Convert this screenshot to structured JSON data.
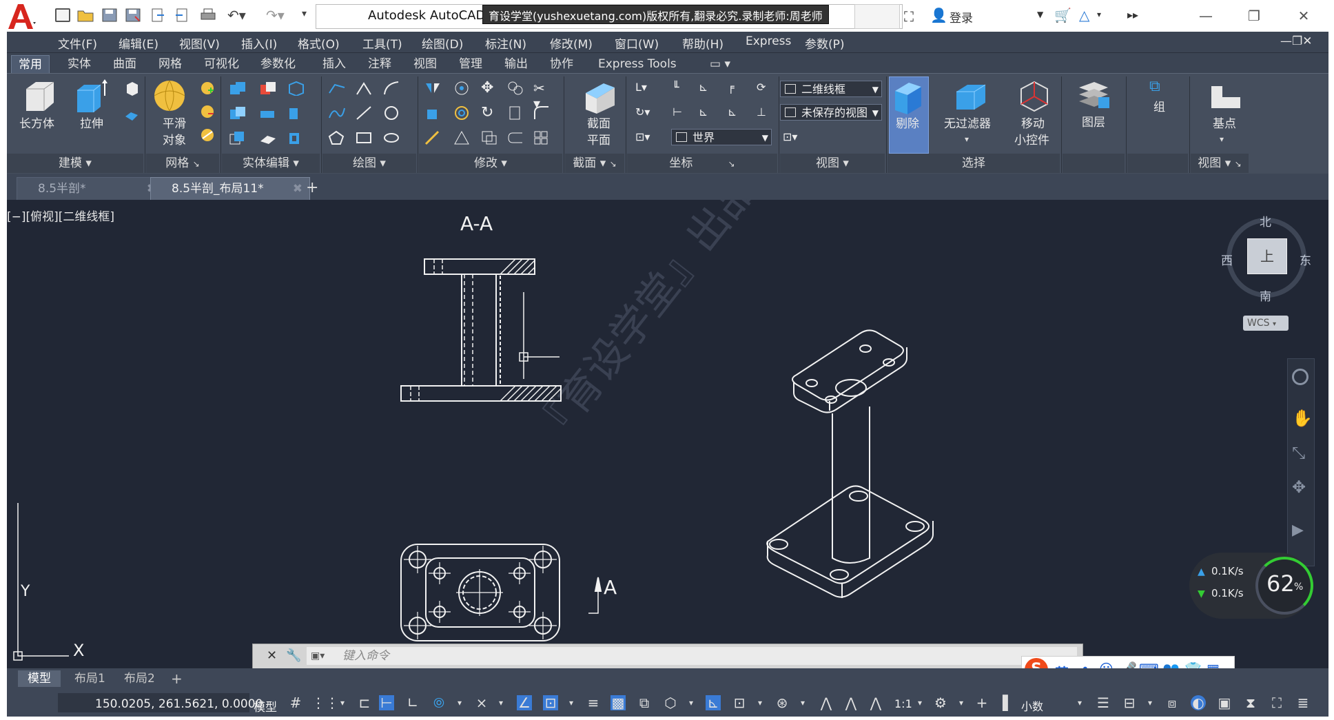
{
  "titlebar": {
    "app_title": "Autodesk AutoCAD",
    "banner": "育设学堂(yushexuetang.com)版权所有,翻录必究.录制老师:周老师",
    "login": "登录"
  },
  "menubar": {
    "items": [
      "文件(F)",
      "编辑(E)",
      "视图(V)",
      "插入(I)",
      "格式(O)",
      "工具(T)",
      "绘图(D)",
      "标注(N)",
      "修改(M)",
      "窗口(W)",
      "帮助(H)",
      "Express",
      "参数(P)"
    ]
  },
  "ribbon_tabs": {
    "items": [
      "常用",
      "实体",
      "曲面",
      "网格",
      "可视化",
      "参数化",
      "插入",
      "注释",
      "视图",
      "管理",
      "输出",
      "协作",
      "Express Tools"
    ]
  },
  "ribbon": {
    "box_label": "长方体",
    "extrude_label": "拉伸",
    "smooth_label_1": "平滑",
    "smooth_label_2": "对象",
    "section_plane_1": "截面",
    "section_plane_2": "平面",
    "visual_style": "二维线框",
    "named_view": "未保存的视图",
    "ucs": "世界",
    "cull_label": "剔除",
    "nofilter_label": "无过滤器",
    "gizmo_label_1": "移动",
    "gizmo_label_2": "小控件",
    "layer_label": "图层",
    "group_label": "组",
    "base_label": "基点",
    "panels": {
      "modeling": "建模",
      "mesh": "网格",
      "solid_edit": "实体编辑",
      "draw": "绘图",
      "modify": "修改",
      "section": "截面",
      "coords": "坐标",
      "view": "视图",
      "selection": "选择",
      "view2": "视图"
    }
  },
  "doctabs": {
    "tab1": "8.5半剖*",
    "tab2": "8.5半剖_布局11*"
  },
  "canvas": {
    "view_label": "[−][俯视][二维线框]",
    "section_title": "A-A",
    "section_marker": "A",
    "watermark": "『育设学堂』出品",
    "viewcube": {
      "north": "北",
      "south": "南",
      "east": "东",
      "west": "西",
      "face": "上",
      "wcs": "WCS"
    },
    "ucs_x": "X",
    "ucs_y": "Y"
  },
  "netwidget": {
    "up": "0.1K/s",
    "down": "0.1K/s",
    "percent": "62",
    "percent_sign": "%"
  },
  "cmdline": {
    "placeholder": "键入命令"
  },
  "layouttabs": {
    "items": [
      "模型",
      "布局1",
      "布局2"
    ]
  },
  "statusbar": {
    "coords": "150.0205, 261.5621, 0.0000",
    "model": "模型",
    "scale": "1:1",
    "units": "小数"
  },
  "ime": {
    "lang": "英"
  }
}
